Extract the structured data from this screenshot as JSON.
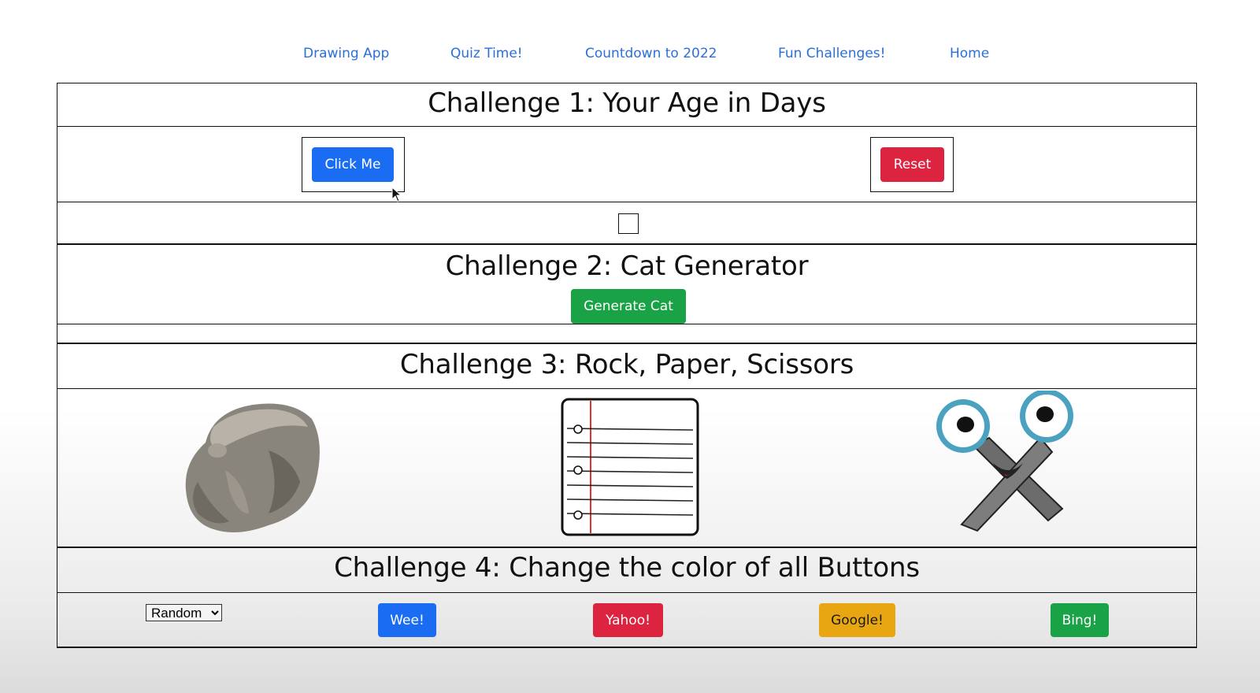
{
  "nav": {
    "links": [
      "Drawing App",
      "Quiz Time!",
      "Countdown to 2022",
      "Fun Challenges!",
      "Home"
    ]
  },
  "challenge1": {
    "title": "Challenge 1: Your Age in Days",
    "click_label": "Click Me",
    "reset_label": "Reset"
  },
  "challenge2": {
    "title": "Challenge 2: Cat Generator",
    "generate_label": "Generate Cat"
  },
  "challenge3": {
    "title": "Challenge 3: Rock, Paper, Scissors",
    "choices": [
      "rock",
      "paper",
      "scissors"
    ]
  },
  "challenge4": {
    "title": "Challenge 4: Change the color of all Buttons",
    "select_value": "Random",
    "buttons": [
      "Wee!",
      "Yahoo!",
      "Google!",
      "Bing!"
    ]
  },
  "colors": {
    "primary": "#1a6df2",
    "danger": "#dc2340",
    "success": "#1aa346",
    "warning": "#e8a712",
    "link": "#2a6fdc"
  }
}
